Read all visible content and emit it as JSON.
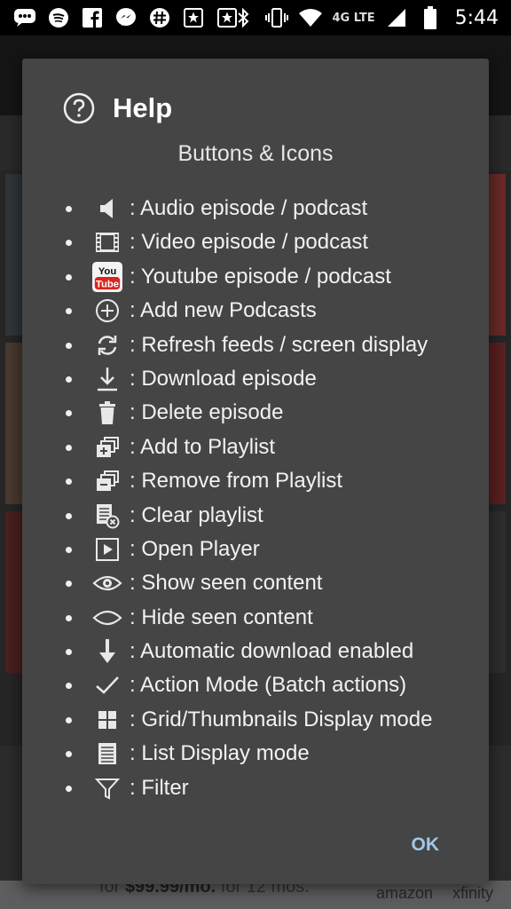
{
  "status_bar": {
    "icons_left": [
      "messages-icon",
      "spotify-icon",
      "facebook-icon",
      "messenger-icon",
      "slack-icon",
      "bookmark-star-icon",
      "bookmark-star-icon"
    ],
    "icons_right": [
      "bluetooth-icon",
      "vibrate-icon",
      "wifi-icon",
      "signal-icon",
      "battery-icon"
    ],
    "network": "4G LTE",
    "time": "5:44"
  },
  "dialog": {
    "title": "Help",
    "subtitle": "Buttons & Icons",
    "items": [
      {
        "icon": "speaker-icon",
        "label": ": Audio episode / podcast"
      },
      {
        "icon": "film-icon",
        "label": ": Video episode / podcast"
      },
      {
        "icon": "youtube-icon",
        "label": ": Youtube episode / podcast"
      },
      {
        "icon": "add-circle-icon",
        "label": ": Add new Podcasts"
      },
      {
        "icon": "refresh-icon",
        "label": ": Refresh feeds / screen display"
      },
      {
        "icon": "download-icon",
        "label": ": Download episode"
      },
      {
        "icon": "trash-icon",
        "label": ": Delete episode"
      },
      {
        "icon": "playlist-add-icon",
        "label": ": Add to Playlist"
      },
      {
        "icon": "playlist-remove-icon",
        "label": ": Remove from Playlist"
      },
      {
        "icon": "clear-playlist-icon",
        "label": ": Clear playlist"
      },
      {
        "icon": "play-box-icon",
        "label": ": Open Player"
      },
      {
        "icon": "eye-icon",
        "label": ": Show seen content"
      },
      {
        "icon": "eye-closed-icon",
        "label": ": Hide seen content"
      },
      {
        "icon": "auto-download-icon",
        "label": ": Automatic download enabled"
      },
      {
        "icon": "checkmark-icon",
        "label": ": Action Mode (Batch actions)"
      },
      {
        "icon": "grid-icon",
        "label": ": Grid/Thumbnails Display mode"
      },
      {
        "icon": "list-icon",
        "label": ": List Display mode"
      },
      {
        "icon": "filter-icon",
        "label": ": Filter"
      }
    ],
    "ok_label": "OK",
    "youtube_badge": {
      "line1": "You",
      "line2": "Tube"
    }
  },
  "background_ad": {
    "text_prefix": "for ",
    "price": "$99.99/mo.",
    "text_suffix": " for 12 mos.",
    "brand1": "amazon",
    "brand2": "xfinity"
  },
  "colors": {
    "dialog_bg": "#454545",
    "ok_text": "#9fc8e8",
    "youtube_red": "#d9261c"
  }
}
